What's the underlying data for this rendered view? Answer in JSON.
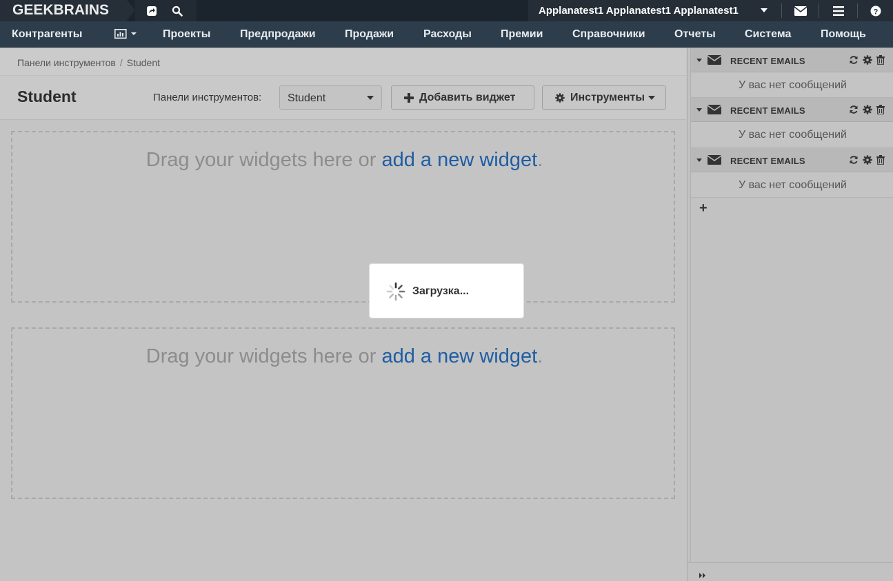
{
  "app": {
    "logo": "GEEKBRAINS"
  },
  "topbar": {
    "user_name": "Applanatest1 Applanatest1 Applanatest1",
    "icons": [
      "share-icon",
      "search-icon",
      "envelope-icon",
      "menu-icon",
      "help-icon"
    ]
  },
  "nav": {
    "items": [
      {
        "label": "Контрагенты"
      },
      {
        "label": "Проекты"
      },
      {
        "label": "Предпродажи"
      },
      {
        "label": "Продажи"
      },
      {
        "label": "Расходы"
      },
      {
        "label": "Премии"
      },
      {
        "label": "Справочники"
      },
      {
        "label": "Отчеты"
      },
      {
        "label": "Система"
      },
      {
        "label": "Помощь"
      }
    ],
    "chart_icon": "bar-chart-icon"
  },
  "breadcrumb": {
    "parent": "Панели инструментов",
    "separator": "/",
    "current": "Student"
  },
  "page": {
    "title": "Student",
    "dashboard_label": "Панели инструментов:",
    "dashboard_selected": "Student",
    "add_widget_label": "Добавить виджет",
    "tools_label": "Инструменты"
  },
  "dropzones": [
    {
      "text": "Drag your widgets here or ",
      "link": "add a new widget",
      "suffix": "."
    },
    {
      "text": "Drag your widgets here or ",
      "link": "add a new widget",
      "suffix": "."
    }
  ],
  "loading": {
    "text": "Загрузка..."
  },
  "sidebar": {
    "widgets": [
      {
        "title": "RECENT EMAILS",
        "empty": "У вас нет сообщений"
      },
      {
        "title": "RECENT EMAILS",
        "empty": "У вас нет сообщений"
      },
      {
        "title": "RECENT EMAILS",
        "empty": "У вас нет сообщений"
      }
    ],
    "add_symbol": "+"
  },
  "colors": {
    "topbar": "#1b242c",
    "navbar": "#2e3d4b",
    "link": "#1f5da3",
    "overlay_gray": "#c4c4c4"
  }
}
